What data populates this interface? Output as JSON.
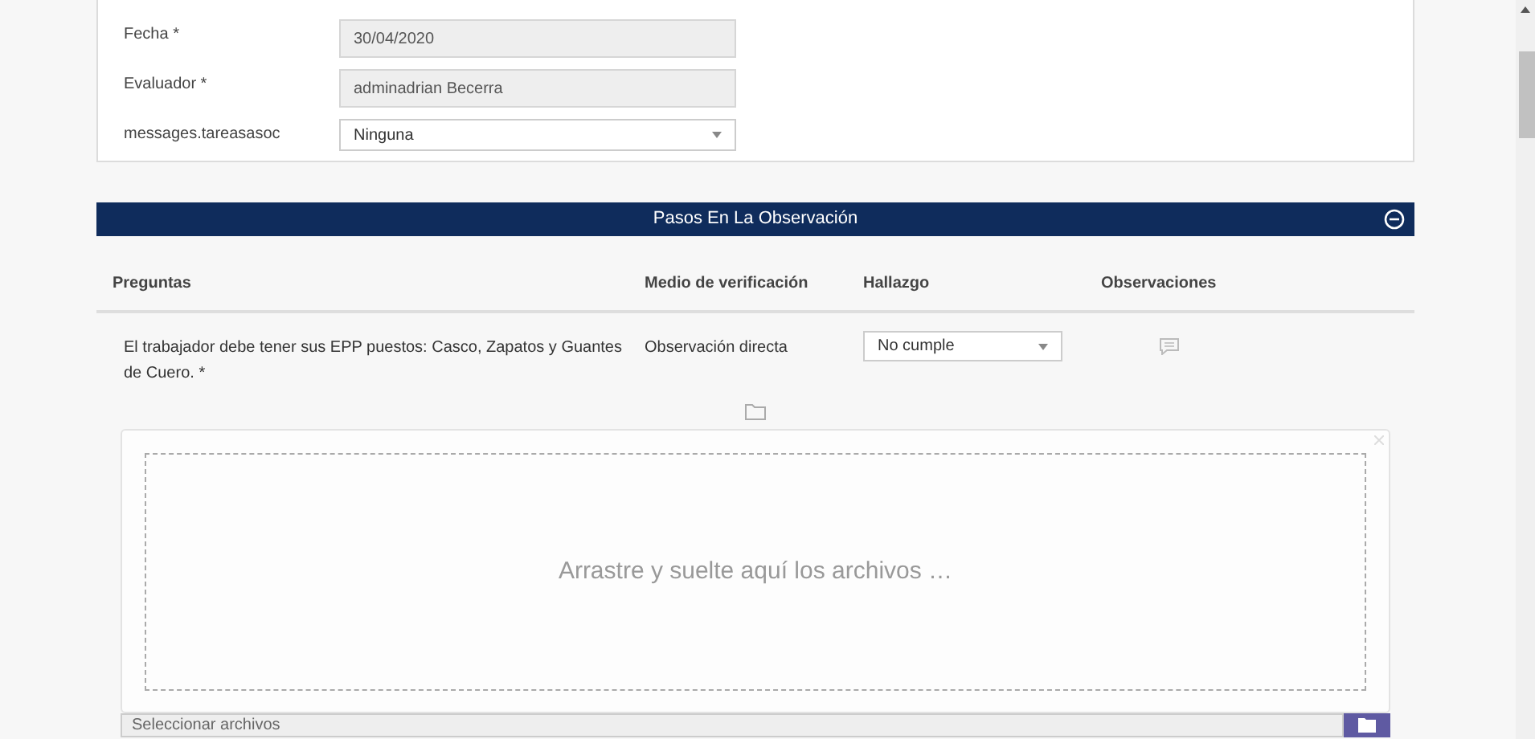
{
  "form": {
    "fields": [
      {
        "label": "Fecha *",
        "value": "30/04/2020",
        "kind": "readonly"
      },
      {
        "label": "Evaluador *",
        "value": "adminadrian Becerra",
        "kind": "readonly"
      },
      {
        "label": "messages.tareasasoc",
        "value": "Ninguna",
        "kind": "select"
      }
    ]
  },
  "section": {
    "title": "Pasos En La Observación",
    "expanded": true
  },
  "table": {
    "columns": [
      "Preguntas",
      "Medio de verificación",
      "Hallazgo",
      "Observaciones"
    ],
    "rows": [
      {
        "question": "El trabajador debe tener sus EPP puestos: Casco, Zapatos y Guantes de Cuero. *",
        "method": "Observación directa",
        "finding": "No cumple"
      }
    ]
  },
  "upload": {
    "dropzone_text": "Arrastre y suelte aquí los archivos …",
    "placeholder": "Seleccionar archivos"
  }
}
